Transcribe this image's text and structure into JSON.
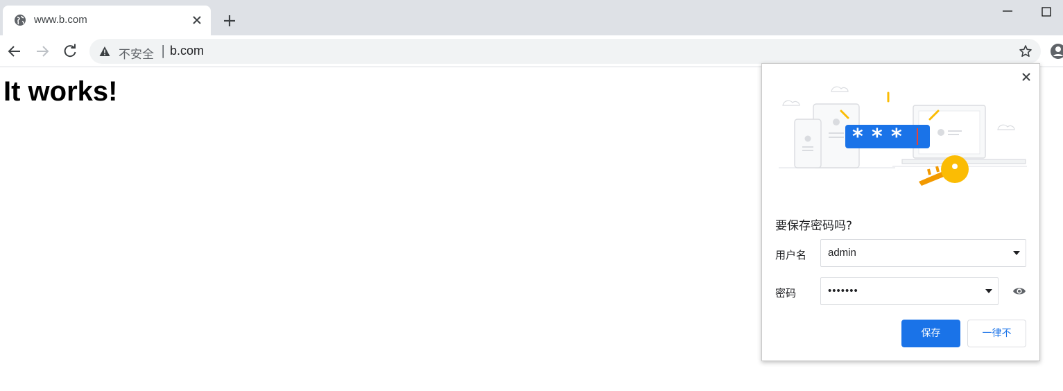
{
  "tab": {
    "title": "www.b.com",
    "favicon": "globe-icon",
    "close_icon": "close-icon"
  },
  "toolbar": {
    "security_label": "不安全",
    "separator": "|",
    "url": "b.com"
  },
  "page": {
    "heading": "It works!"
  },
  "password_bubble": {
    "title": "要保存密码吗?",
    "username_label": "用户名",
    "username_value": "admin",
    "password_label": "密码",
    "password_value": "•••••••",
    "save_label": "保存",
    "never_label": "一律不"
  },
  "colors": {
    "accent": "#1a73e8",
    "tabstrip": "#dee1e6",
    "omnibox": "#f1f3f4",
    "key_yellow": "#fbbc04"
  }
}
